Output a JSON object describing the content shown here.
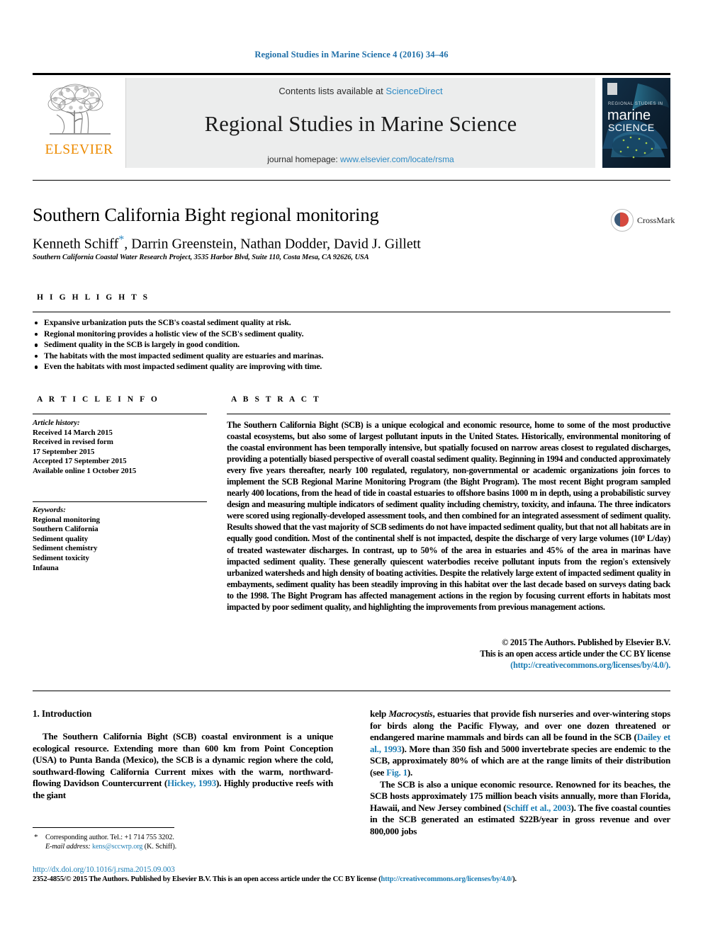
{
  "running_head": "Regional Studies in Marine Science 4 (2016) 34–46",
  "masthead": {
    "publisher_name": "ELSEVIER",
    "contents_prefix": "Contents lists available at ",
    "contents_link": "ScienceDirect",
    "journal_title": "Regional Studies in Marine Science",
    "homepage_prefix": "journal homepage: ",
    "homepage_url": "www.elsevier.com/locate/rsma",
    "cover_line1": "REGIONAL STUDIES IN",
    "cover_line2": "marine",
    "cover_line3": "SCIENCE"
  },
  "article": {
    "title": "Southern California Bight regional monitoring",
    "authors": "Kenneth Schiff",
    "authors_rest": ", Darrin Greenstein, Nathan Dodder, David J. Gillett",
    "corresponding_marker": "*",
    "affiliation": "Southern California Coastal Water Research Project, 3535 Harbor Blvd, Suite 110, Costa Mesa, CA 92626, USA",
    "crossmark_label": "CrossMark"
  },
  "highlights": {
    "heading": "H I G H L I G H T S",
    "items": [
      "Expansive urbanization puts the SCB's coastal sediment quality at risk.",
      "Regional monitoring provides a holistic view of the SCB's sediment quality.",
      "Sediment quality in the SCB is largely in good condition.",
      "The habitats with the most impacted sediment quality are estuaries and marinas.",
      "Even the habitats with most impacted sediment quality are improving with time."
    ]
  },
  "article_info": {
    "heading": "A R T I C L E    I N F O",
    "history_label": "Article history:",
    "history_lines": [
      "Received 14 March 2015",
      "Received in revised form",
      "17 September 2015",
      "Accepted 17 September 2015",
      "Available online 1 October 2015"
    ],
    "keywords_label": "Keywords:",
    "keywords": [
      "Regional monitoring",
      "Southern California",
      "Sediment quality",
      "Sediment chemistry",
      "Sediment toxicity",
      "Infauna"
    ]
  },
  "abstract": {
    "heading": "A B S T R A C T",
    "text": "The Southern California Bight (SCB) is a unique ecological and economic resource, home to some of the most productive coastal ecosystems, but also some of largest pollutant inputs in the United States. Historically, environmental monitoring of the coastal environment has been temporally intensive, but spatially focused on narrow areas closest to regulated discharges, providing a potentially biased perspective of overall coastal sediment quality. Beginning in 1994 and conducted approximately every five years thereafter, nearly 100 regulated, regulatory, non-governmental or academic organizations join forces to implement the SCB Regional Marine Monitoring Program (the Bight Program). The most recent Bight program sampled nearly 400 locations, from the head of tide in coastal estuaries to offshore basins 1000 m in depth, using a probabilistic survey design and measuring multiple indicators of sediment quality including chemistry, toxicity, and infauna. The three indicators were scored using regionally-developed assessment tools, and then combined for an integrated assessment of sediment quality. Results showed that the vast majority of SCB sediments do not have impacted sediment quality, but that not all habitats are in equally good condition. Most of the continental shelf is not impacted, despite the discharge of very large volumes (10⁹ L/day) of treated wastewater discharges. In contrast, up to 50% of the area in estuaries and 45% of the area in marinas have impacted sediment quality. These generally quiescent waterbodies receive pollutant inputs from the region's extensively urbanized watersheds and high density of boating activities. Despite the relatively large extent of impacted sediment quality in embayments, sediment quality has been steadily improving in this habitat over the last decade based on surveys dating back to the 1998. The Bight Program has affected management actions in the region by focusing current efforts in habitats most impacted by poor sediment quality, and highlighting the improvements from previous management actions.",
    "copyright_line1": "© 2015 The Authors. Published by Elsevier B.V.",
    "copyright_line2": "This is an open access article under the CC BY license",
    "copyright_link": "(http://creativecommons.org/licenses/by/4.0/)."
  },
  "body": {
    "section_heading": "1. Introduction",
    "left_paragraph_1_a": "The Southern California Bight (SCB) coastal environment is a unique ecological resource. Extending more than 600 km from Point Conception (USA) to Punta Banda (Mexico), the SCB is a dynamic region where the cold, southward-flowing California Current mixes with the warm, northward-flowing Davidson Countercurrent (",
    "left_ref_1": "Hickey, 1993",
    "left_paragraph_1_b": "). Highly productive reefs with the giant",
    "right_paragraph_1_a": "kelp ",
    "right_italic_1": "Macrocystis",
    "right_paragraph_1_b": ", estuaries that provide fish nurseries and over-wintering stops for birds along the Pacific Flyway, and over one dozen threatened or endangered marine mammals and birds can all be found in the SCB (",
    "right_ref_1": "Dailey et al., 1993",
    "right_paragraph_1_c": "). More than 350 fish and 5000 invertebrate species are endemic to the SCB, approximately 80% of which are at the range limits of their distribution (see ",
    "right_ref_2": "Fig. 1",
    "right_paragraph_1_d": ").",
    "right_paragraph_2_a": "The SCB is also a unique economic resource. Renowned for its beaches, the SCB hosts approximately 175 million beach visits annually, more than Florida, Hawaii, and New Jersey combined (",
    "right_ref_3": "Schiff et al., 2003",
    "right_paragraph_2_b": "). The five coastal counties in the SCB generated an estimated $22B/year in gross revenue and over 800,000 jobs"
  },
  "footer": {
    "corresponding_marker": "*",
    "corresponding_text": "Corresponding author. Tel.: +1 714 755 3202.",
    "email_label": "E-mail address:",
    "email": "kens@sccwrp.org",
    "email_suffix": "(K. Schiff).",
    "doi": "http://dx.doi.org/10.1016/j.rsma.2015.09.003",
    "issn_line_a": "2352-4855/© 2015 The Authors. Published by Elsevier B.V. This is an open access article under the CC BY license (",
    "issn_link": "http://creativecommons.org/licenses/by/4.0/",
    "issn_line_b": ")."
  },
  "colors": {
    "link": "#1f7fb5",
    "elsevier_orange": "#ED8B00",
    "masthead_grey": "#eceded"
  }
}
